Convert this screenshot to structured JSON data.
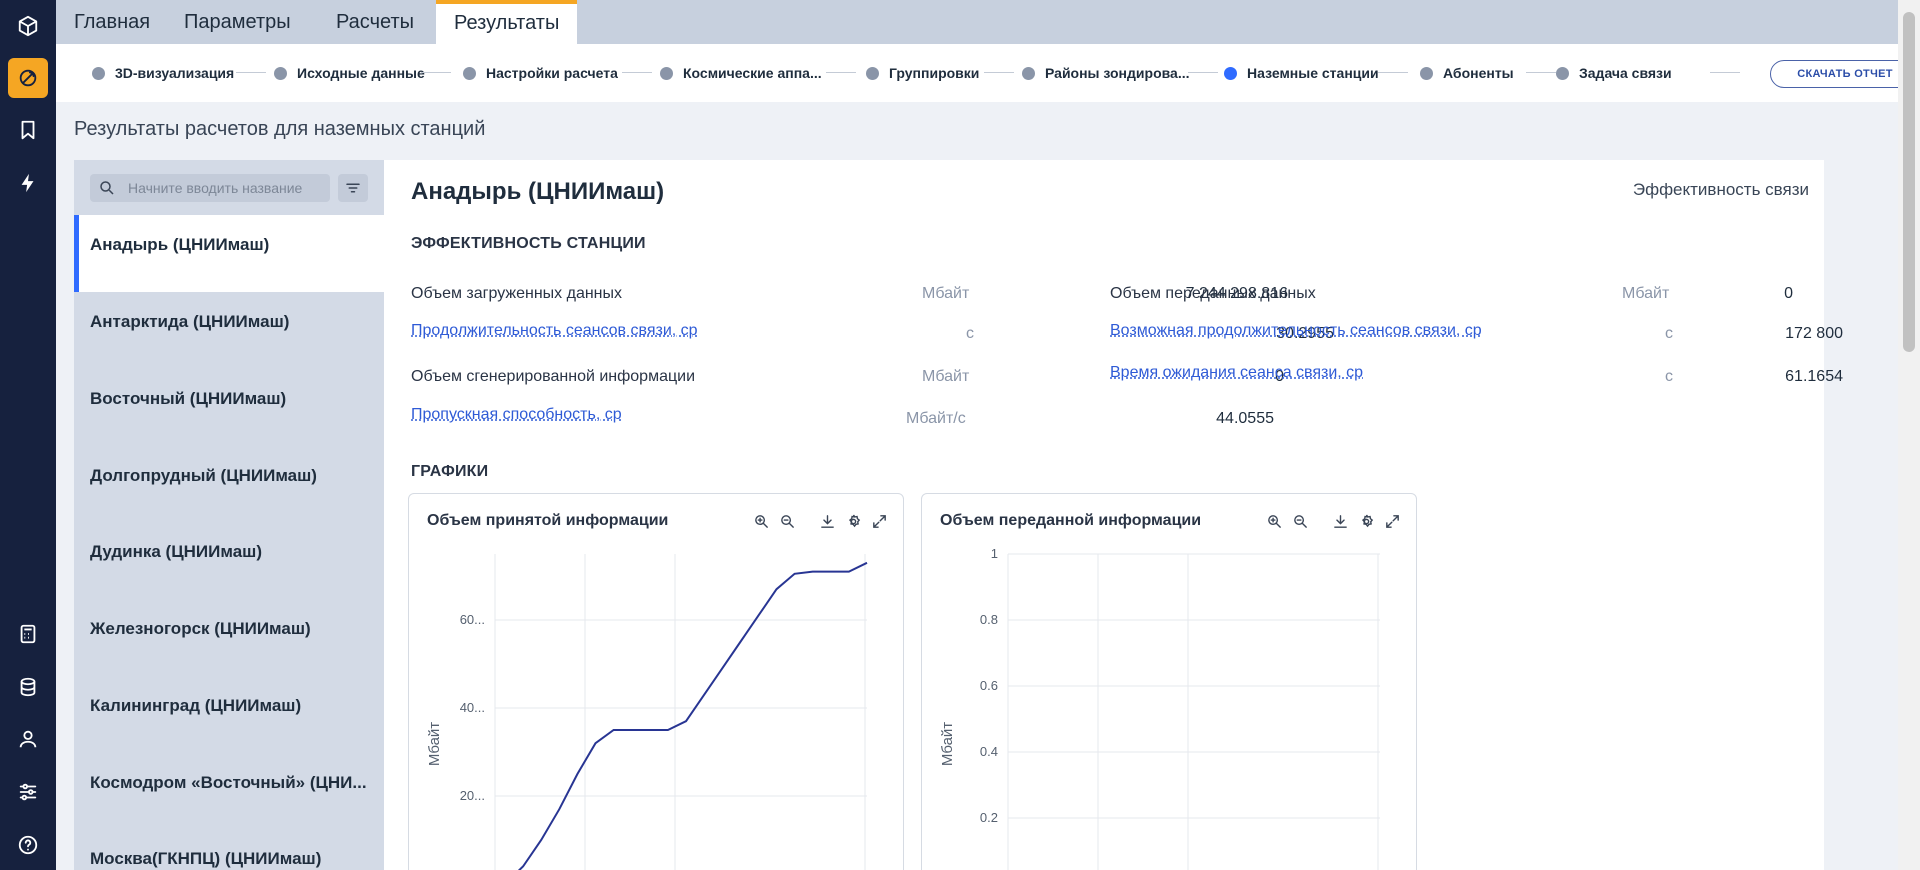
{
  "nav_rail": {
    "items": [
      {
        "name": "cube-icon"
      },
      {
        "name": "satellite-dish-icon",
        "active": true
      },
      {
        "name": "bookmark-icon"
      },
      {
        "name": "lightning-icon"
      },
      {
        "name": "calculator-icon"
      },
      {
        "name": "database-icon"
      },
      {
        "name": "user-icon"
      },
      {
        "name": "sliders-icon"
      },
      {
        "name": "help-icon"
      }
    ]
  },
  "tabs": [
    {
      "label": "Главная"
    },
    {
      "label": "Параметры"
    },
    {
      "label": "Расчеты"
    },
    {
      "label": "Результаты",
      "active": true
    }
  ],
  "stepper": {
    "steps": [
      {
        "label": "3D-визуализация"
      },
      {
        "label": "Исходные данные"
      },
      {
        "label": "Настройки расчета"
      },
      {
        "label": "Космические аппа..."
      },
      {
        "label": "Группировки"
      },
      {
        "label": "Районы зондирова..."
      },
      {
        "label": "Наземные станции",
        "active": true
      },
      {
        "label": "Абоненты"
      },
      {
        "label": "Задача связи"
      }
    ],
    "report_button": "СКАЧАТЬ ОТЧЕТ"
  },
  "page_title": "Результаты расчетов для наземных станций",
  "station_list": {
    "search_placeholder": "Начните вводить название",
    "items": [
      {
        "label": "Анадырь (ЦНИИмаш)",
        "active": true
      },
      {
        "label": "Антарктида (ЦНИИмаш)"
      },
      {
        "label": "Восточный (ЦНИИмаш)"
      },
      {
        "label": "Долгопрудный (ЦНИИмаш)"
      },
      {
        "label": "Дудинка (ЦНИИмаш)"
      },
      {
        "label": "Железногорск (ЦНИИмаш)"
      },
      {
        "label": "Калининград (ЦНИИмаш)"
      },
      {
        "label": "Космодром «Восточный» (ЦНИ..."
      },
      {
        "label": "Москва(ГКНПЦ) (ЦНИИмаш)"
      }
    ]
  },
  "main": {
    "station_title": "Анадырь (ЦНИИмаш)",
    "efficiency_link": "Эффективность связи",
    "efficiency_section": "ЭФФЕКТИВНОСТЬ СТАНЦИИ",
    "metrics_left": [
      {
        "label": "Объем загруженных данных",
        "value": "7 244 298.816",
        "unit": "Мбайт",
        "link": false
      },
      {
        "label": "Продолжительность сеансов связи, ср",
        "value": "30.2955",
        "unit": "с",
        "link": true
      },
      {
        "label": "Объем сгенерированной информации",
        "value": "0",
        "unit": "Мбайт",
        "link": false
      },
      {
        "label": "Пропускная способность, ср",
        "value": "44.0555",
        "unit": "Мбайт/с",
        "link": true
      }
    ],
    "metrics_right": [
      {
        "label": "Объем переданных данных",
        "value": "0",
        "unit": "Мбайт",
        "link": false
      },
      {
        "label": "Возможная продолжительность сеансов связи, ср",
        "value": "172 800",
        "unit": "с",
        "link": true
      },
      {
        "label": "Время ожидания сеанса связи, ср",
        "value": "61.1654",
        "unit": "с",
        "link": true
      }
    ],
    "charts_section": "ГРАФИКИ"
  },
  "colors": {
    "accent": "#f5a623",
    "active_blue": "#2f6bff",
    "rail_bg": "#16213e",
    "series_line": "#283593"
  },
  "chart_data": [
    {
      "type": "line",
      "title": "Объем принятой информации",
      "ylabel": "Мбайт",
      "ylim": [
        0,
        75
      ],
      "y_ticks": [
        "20...",
        "40...",
        "60..."
      ],
      "x": [
        0,
        0.05,
        0.1,
        0.15,
        0.2,
        0.25,
        0.3,
        0.35,
        0.4,
        0.45,
        0.5,
        0.55,
        0.6,
        0.65,
        0.7,
        0.75,
        0.8,
        0.85,
        0.9,
        0.95,
        1.0
      ],
      "series": [
        {
          "values": [
            0,
            4,
            10,
            17,
            25,
            32,
            35,
            35,
            35,
            35,
            37,
            43,
            49,
            55,
            61,
            67,
            70.5,
            71,
            71,
            71,
            73
          ]
        }
      ]
    },
    {
      "type": "line",
      "title": "Объем переданной информации",
      "ylabel": "Мбайт",
      "ylim": [
        0,
        1
      ],
      "y_ticks": [
        "0.2",
        "0.4",
        "0.6",
        "0.8",
        "1"
      ],
      "series": []
    }
  ]
}
